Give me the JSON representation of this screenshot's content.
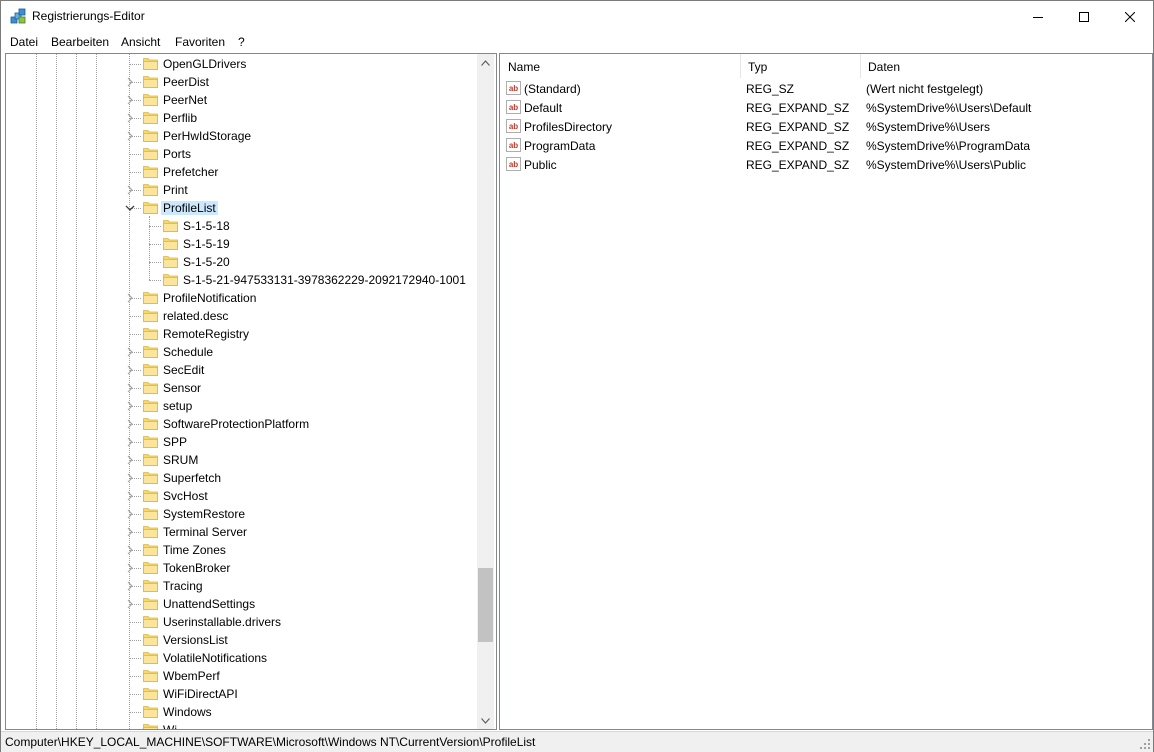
{
  "window": {
    "title": "Registrierungs-Editor"
  },
  "menu": [
    "Datei",
    "Bearbeiten",
    "Ansicht",
    "Favoriten",
    "?"
  ],
  "tree": {
    "items": [
      {
        "label": "OpenGLDrivers",
        "level": 0,
        "expander": "none"
      },
      {
        "label": "PeerDist",
        "level": 0,
        "expander": "collapsed"
      },
      {
        "label": "PeerNet",
        "level": 0,
        "expander": "collapsed"
      },
      {
        "label": "Perflib",
        "level": 0,
        "expander": "collapsed"
      },
      {
        "label": "PerHwIdStorage",
        "level": 0,
        "expander": "collapsed"
      },
      {
        "label": "Ports",
        "level": 0,
        "expander": "none"
      },
      {
        "label": "Prefetcher",
        "level": 0,
        "expander": "none"
      },
      {
        "label": "Print",
        "level": 0,
        "expander": "collapsed"
      },
      {
        "label": "ProfileList",
        "level": 0,
        "expander": "expanded",
        "selected": true
      },
      {
        "label": "S-1-5-18",
        "level": 1,
        "expander": "none"
      },
      {
        "label": "S-1-5-19",
        "level": 1,
        "expander": "none"
      },
      {
        "label": "S-1-5-20",
        "level": 1,
        "expander": "none"
      },
      {
        "label": "S-1-5-21-947533131-3978362229-2092172940-1001",
        "level": 1,
        "expander": "none",
        "last": true
      },
      {
        "label": "ProfileNotification",
        "level": 0,
        "expander": "collapsed"
      },
      {
        "label": "related.desc",
        "level": 0,
        "expander": "none"
      },
      {
        "label": "RemoteRegistry",
        "level": 0,
        "expander": "none"
      },
      {
        "label": "Schedule",
        "level": 0,
        "expander": "collapsed"
      },
      {
        "label": "SecEdit",
        "level": 0,
        "expander": "collapsed"
      },
      {
        "label": "Sensor",
        "level": 0,
        "expander": "collapsed"
      },
      {
        "label": "setup",
        "level": 0,
        "expander": "collapsed"
      },
      {
        "label": "SoftwareProtectionPlatform",
        "level": 0,
        "expander": "collapsed"
      },
      {
        "label": "SPP",
        "level": 0,
        "expander": "collapsed"
      },
      {
        "label": "SRUM",
        "level": 0,
        "expander": "collapsed"
      },
      {
        "label": "Superfetch",
        "level": 0,
        "expander": "collapsed"
      },
      {
        "label": "SvcHost",
        "level": 0,
        "expander": "collapsed"
      },
      {
        "label": "SystemRestore",
        "level": 0,
        "expander": "collapsed"
      },
      {
        "label": "Terminal Server",
        "level": 0,
        "expander": "collapsed"
      },
      {
        "label": "Time Zones",
        "level": 0,
        "expander": "collapsed"
      },
      {
        "label": "TokenBroker",
        "level": 0,
        "expander": "collapsed"
      },
      {
        "label": "Tracing",
        "level": 0,
        "expander": "collapsed"
      },
      {
        "label": "UnattendSettings",
        "level": 0,
        "expander": "collapsed"
      },
      {
        "label": "Userinstallable.drivers",
        "level": 0,
        "expander": "none"
      },
      {
        "label": "VersionsList",
        "level": 0,
        "expander": "none"
      },
      {
        "label": "VolatileNotifications",
        "level": 0,
        "expander": "none"
      },
      {
        "label": "WbemPerf",
        "level": 0,
        "expander": "none"
      },
      {
        "label": "WiFiDirectAPI",
        "level": 0,
        "expander": "none"
      },
      {
        "label": "Windows",
        "level": 0,
        "expander": "none"
      },
      {
        "label": "Wi",
        "level": 0,
        "expander": "none"
      }
    ]
  },
  "list": {
    "columns": [
      "Name",
      "Typ",
      "Daten"
    ],
    "rows": [
      {
        "name": "(Standard)",
        "type": "REG_SZ",
        "data": "(Wert nicht festgelegt)"
      },
      {
        "name": "Default",
        "type": "REG_EXPAND_SZ",
        "data": "%SystemDrive%\\Users\\Default"
      },
      {
        "name": "ProfilesDirectory",
        "type": "REG_EXPAND_SZ",
        "data": "%SystemDrive%\\Users"
      },
      {
        "name": "ProgramData",
        "type": "REG_EXPAND_SZ",
        "data": "%SystemDrive%\\ProgramData"
      },
      {
        "name": "Public",
        "type": "REG_EXPAND_SZ",
        "data": "%SystemDrive%\\Users\\Public"
      }
    ]
  },
  "status": {
    "path": "Computer\\HKEY_LOCAL_MACHINE\\SOFTWARE\\Microsoft\\Windows NT\\CurrentVersion\\ProfileList"
  },
  "icons": {
    "folder": "folder-icon",
    "value": "string-value-icon",
    "app": "registry-editor-icon"
  },
  "colors": {
    "selection": "#cce8ff",
    "folder": "#f6d86b",
    "value_icon": "#c0392b"
  }
}
